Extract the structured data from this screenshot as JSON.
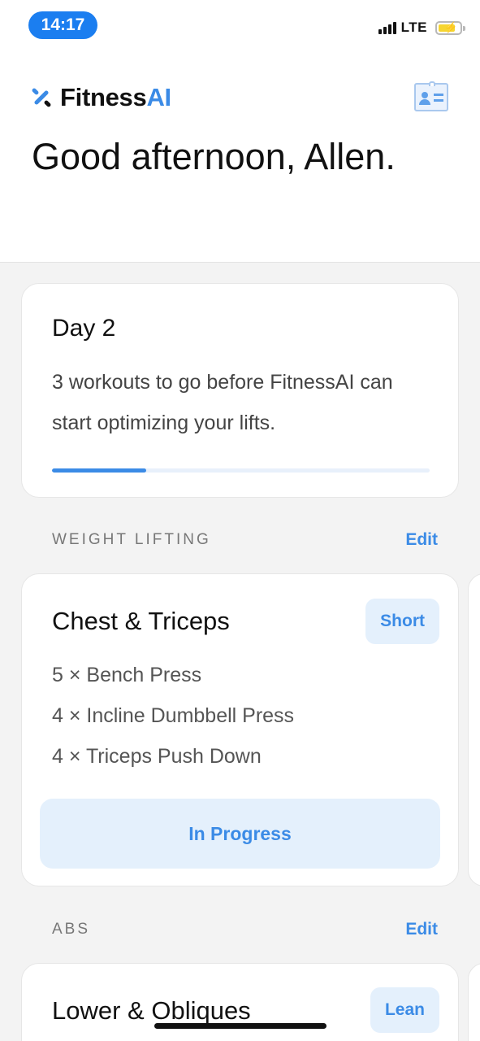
{
  "status_bar": {
    "time": "14:17",
    "network": "LTE"
  },
  "header": {
    "logo_name": "Fitness",
    "logo_accent": "AI",
    "profile_icon": "profile-card-icon",
    "greeting": "Good afternoon, Allen."
  },
  "progress_card": {
    "title": "Day 2",
    "description": "3 workouts to go before FitnessAI can start optimizing your lifts.",
    "progress_fraction": 0.25
  },
  "sections": [
    {
      "label": "WEIGHT LIFTING",
      "edit_label": "Edit",
      "workout": {
        "title": "Chest & Triceps",
        "badge": "Short",
        "exercises": [
          "5 × Bench Press",
          "4 × Incline Dumbbell Press",
          "4 × Triceps Push Down"
        ],
        "action_label": "In Progress"
      }
    },
    {
      "label": "ABS",
      "edit_label": "Edit",
      "workout": {
        "title": "Lower & Obliques",
        "badge": "Lean"
      }
    }
  ],
  "colors": {
    "accent": "#3b8be6",
    "accent_light": "#e4f0fc",
    "status_pill": "#1b7ef0",
    "background": "#f3f3f3"
  }
}
